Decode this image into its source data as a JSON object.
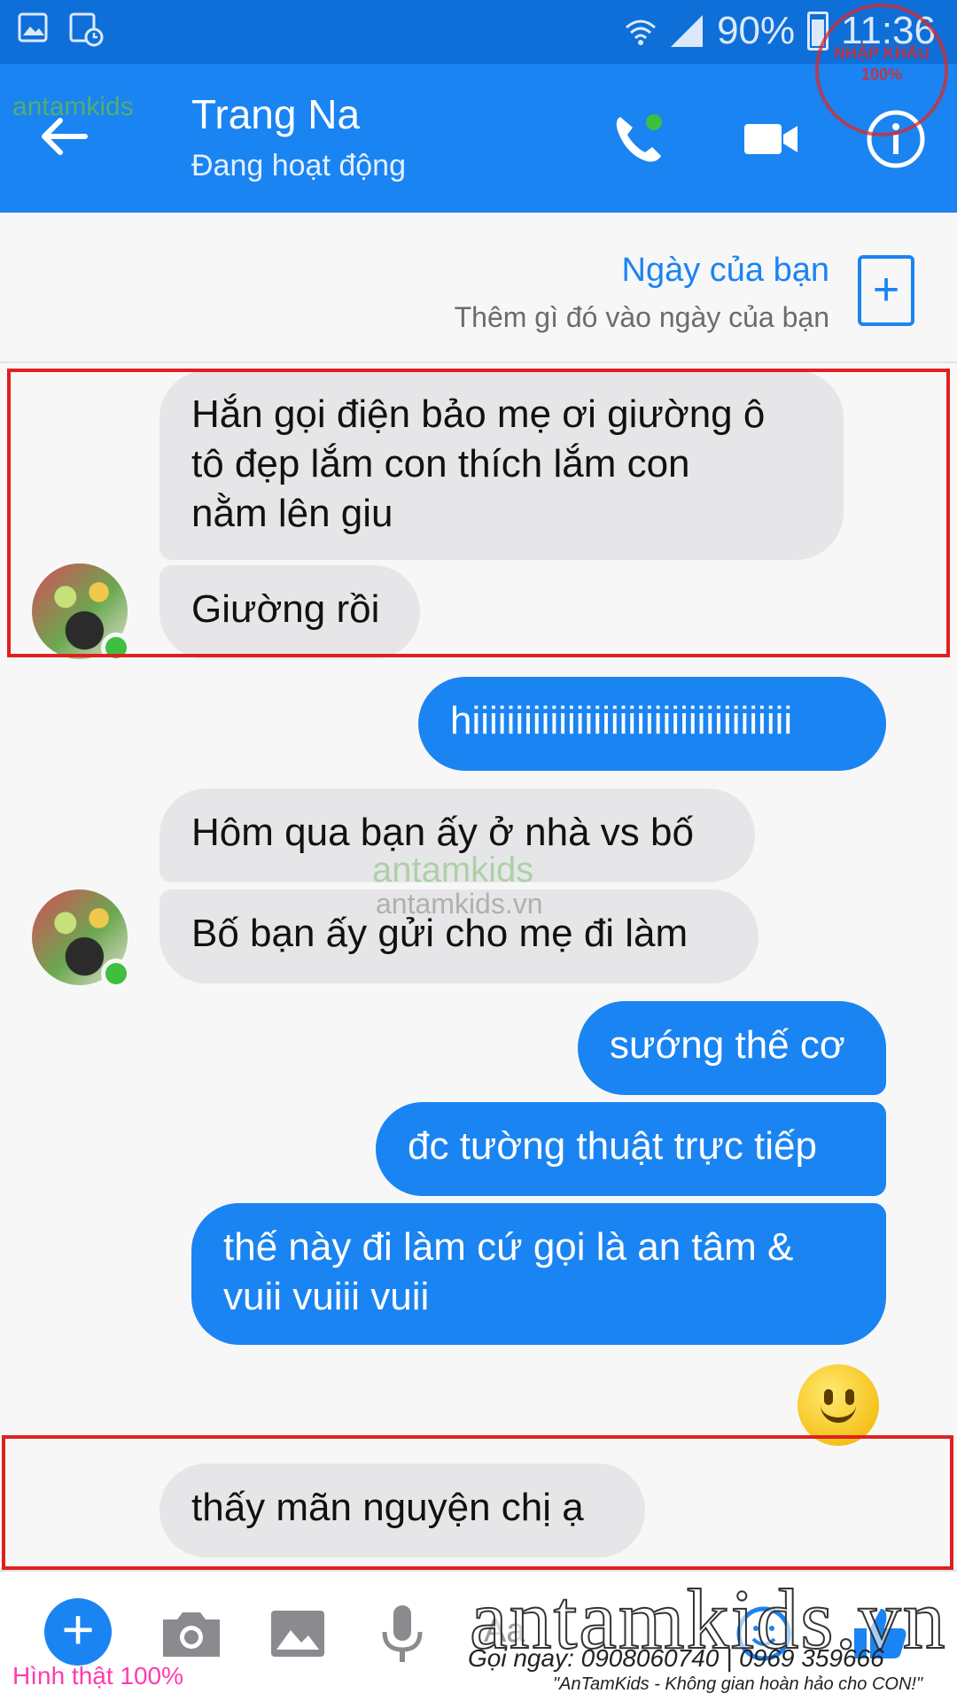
{
  "status_bar": {
    "battery": "90%",
    "time": "11:36",
    "icons": [
      "gallery-icon",
      "alarm-icon",
      "wifi-icon",
      "signal-icon",
      "battery-icon"
    ]
  },
  "header": {
    "contact_name": "Trang Na",
    "contact_status": "Đang hoạt động",
    "icons": [
      "back-arrow-icon",
      "phone-icon",
      "video-icon",
      "info-icon"
    ]
  },
  "day": {
    "title": "Ngày của bạn",
    "subtitle": "Thêm gì đó vào ngày của bạn",
    "add_label": "+"
  },
  "messages": [
    {
      "dir": "in",
      "text": "Hắn gọi điện bảo mẹ ơi giường ô\ntô đẹp lắm con thích lắm con\nnằm lên giu"
    },
    {
      "dir": "in",
      "text": "Giường rồi"
    },
    {
      "dir": "out",
      "text": "hiiiiiiiiiiiiiiiiiiiiiiiiiiiiiiiiiiiii"
    },
    {
      "dir": "in",
      "text": "Hôm qua bạn ấy ở nhà vs bố"
    },
    {
      "dir": "in",
      "text": "Bố bạn ấy gửi cho mẹ đi làm"
    },
    {
      "dir": "out",
      "text": "sướng thế cơ"
    },
    {
      "dir": "out",
      "text": "đc tường thuật trực tiếp"
    },
    {
      "dir": "out",
      "text": "thế này đi làm cứ gọi là an tâm &\nvuii vuiii vuii"
    },
    {
      "dir": "in",
      "text": "thấy mãn nguyện chị ạ"
    }
  ],
  "toolbar": {
    "plus_label": "+",
    "input_placeholder": "Aa",
    "icons": [
      "plus-icon",
      "camera-icon",
      "image-icon",
      "microphone-icon",
      "emoji-icon",
      "like-icon"
    ]
  },
  "watermark": {
    "logo": "antamkids",
    "url": "antamkids.vn",
    "big_logo": "antamkids.vn",
    "phone": "Gọi ngay: 0908060740 | 0969 359666",
    "slogan": "\"AnTamKids - Không gian hoàn hảo cho CON!\"",
    "real_photo": "Hình thật 100%",
    "stamp": "NHẬP KHẨU 100%"
  },
  "colors": {
    "brand_blue": "#1a84f2",
    "status_bar_blue": "#0e6fd9",
    "incoming_bubble": "#e6e6e8",
    "highlight_red": "#e02020",
    "online_green": "#3fbf3f"
  }
}
